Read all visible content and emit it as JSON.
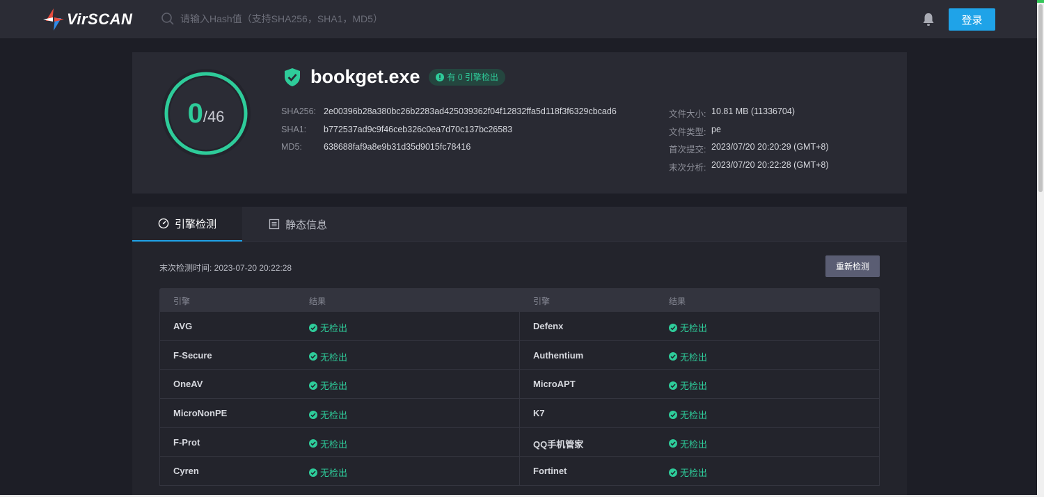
{
  "nav": {
    "logo_text": "VirSCAN",
    "search_placeholder": "请输入Hash值（支持SHA256，SHA1，MD5）",
    "login_label": "登录",
    "accent_color": "#1fa3e8"
  },
  "summary": {
    "detected": "0",
    "total": "/46",
    "file_name": "bookget.exe",
    "status_badge": "有 0 引擎检出",
    "hashes": [
      {
        "label": "SHA256:",
        "value": "2e00396b28a380bc26b2283ad425039362f04f12832ffa5d118f3f6329cbcad6"
      },
      {
        "label": "SHA1:",
        "value": "b772537ad9c9f46ceb326c0ea7d70c137bc26583"
      },
      {
        "label": "MD5:",
        "value": "638688faf9a8e9b31d35d9015fc78416"
      }
    ],
    "meta": [
      {
        "label": "文件大小:",
        "value": "10.81 MB (11336704)"
      },
      {
        "label": "文件类型:",
        "value": "pe"
      },
      {
        "label": "首次提交:",
        "value": "2023/07/20 20:20:29 (GMT+8)"
      },
      {
        "label": "末次分析:",
        "value": "2023/07/20 20:22:28 (GMT+8)"
      }
    ],
    "status_color": "#2ecc9a"
  },
  "tabs": [
    {
      "label": "引擎检测",
      "icon": "gauge-icon"
    },
    {
      "label": "静态信息",
      "icon": "document-icon"
    }
  ],
  "scan": {
    "last_check": "末次检测时间: 2023-07-20 20:22:28",
    "rescan_label": "重新检测",
    "headers": [
      "引擎",
      "结果",
      "引擎",
      "结果"
    ],
    "rows": [
      {
        "engine_left": "AVG",
        "result_left": "无检出",
        "engine_right": "Defenx",
        "result_right": "无检出"
      },
      {
        "engine_left": "F-Secure",
        "result_left": "无检出",
        "engine_right": "Authentium",
        "result_right": "无检出"
      },
      {
        "engine_left": "OneAV",
        "result_left": "无检出",
        "engine_right": "MicroAPT",
        "result_right": "无检出"
      },
      {
        "engine_left": "MicroNonPE",
        "result_left": "无检出",
        "engine_right": "K7",
        "result_right": "无检出"
      },
      {
        "engine_left": "F-Prot",
        "result_left": "无检出",
        "engine_right": "QQ手机管家",
        "result_right": "无检出"
      },
      {
        "engine_left": "Cyren",
        "result_left": "无检出",
        "engine_right": "Fortinet",
        "result_right": "无检出"
      }
    ]
  }
}
